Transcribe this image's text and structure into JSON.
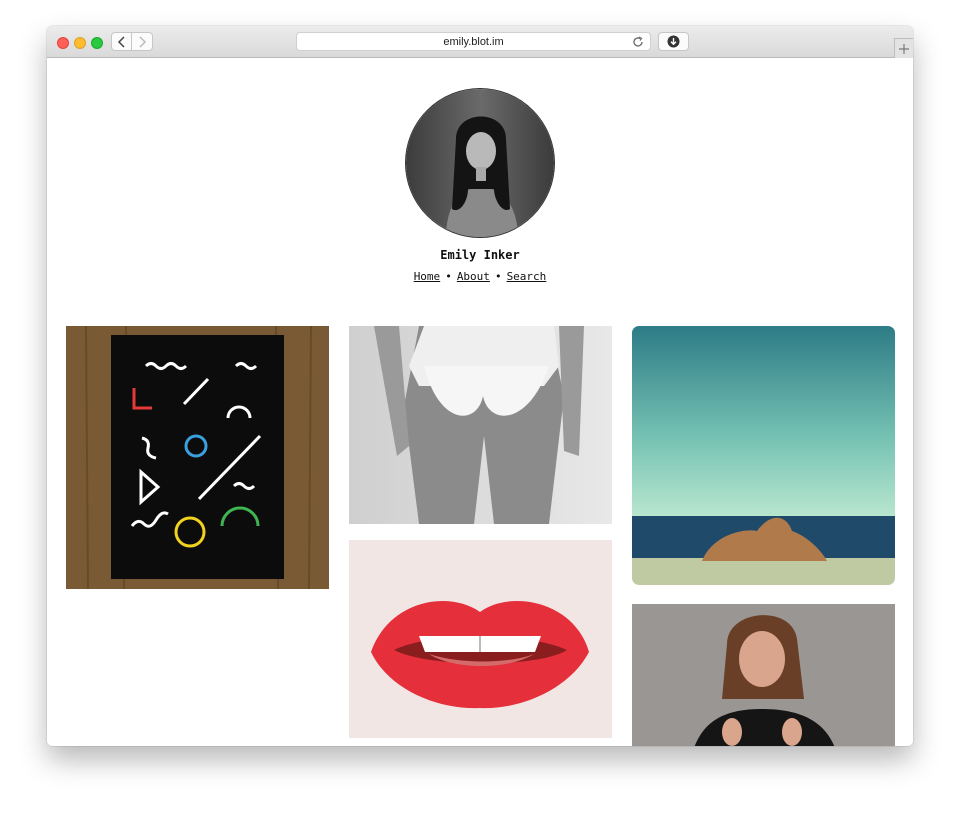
{
  "browser": {
    "url": "emily.blot.im"
  },
  "site": {
    "author_name": "Emily Inker",
    "nav": [
      {
        "label": "Home"
      },
      {
        "label": "About"
      },
      {
        "label": "Search"
      }
    ],
    "separator": "•"
  },
  "icons": {
    "back": "chevron-left-icon",
    "forward": "chevron-right-icon",
    "reload": "reload-icon",
    "download": "download-icon",
    "new_tab": "plus-icon"
  },
  "colors": {
    "traffic_close": "#ff5f57",
    "traffic_minimize": "#febc2e",
    "traffic_zoom": "#28c840",
    "text": "#111111"
  }
}
